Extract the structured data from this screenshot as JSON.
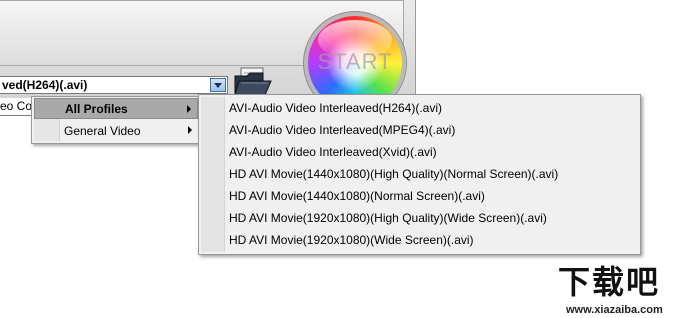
{
  "toolbar": {
    "profile_value": "ved(H264)(.avi)",
    "second_field_value": "eo Cor",
    "start_label": "START",
    "icons": {
      "folder": "folder-open-icon",
      "dropdown": "chevron-down-icon",
      "submenu_arrow": "chevron-right-icon"
    }
  },
  "context_menu": {
    "items": [
      {
        "label": "All Profiles",
        "selected": true
      },
      {
        "label": "General Video",
        "selected": false
      }
    ]
  },
  "submenu": {
    "items": [
      "AVI-Audio Video Interleaved(H264)(.avi)",
      "AVI-Audio Video Interleaved(MPEG4)(.avi)",
      "AVI-Audio Video Interleaved(Xvid)(.avi)",
      "HD AVI Movie(1440x1080)(High Quality)(Normal Screen)(.avi)",
      "HD AVI Movie(1440x1080)(Normal Screen)(.avi)",
      "HD AVI Movie(1920x1080)(High Quality)(Wide Screen)(.avi)",
      "HD AVI Movie(1920x1080)(Wide Screen)(.avi)"
    ]
  },
  "watermark": {
    "logo_text": "下载吧",
    "url": "www.xiazaiba.com"
  },
  "colors": {
    "menu_highlight": "#a9a9a9",
    "menu_background": "#f0f0f0",
    "dropdown_button": "#9cc3ea"
  }
}
